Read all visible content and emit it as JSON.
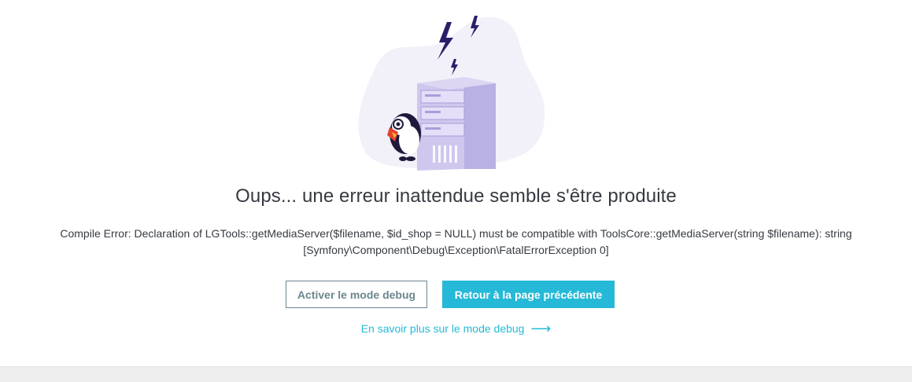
{
  "error_page": {
    "title": "Oups... une erreur inattendue semble s'être produite",
    "message_line1": "Compile Error: Declaration of LGTools::getMediaServer($filename, $id_shop = NULL) must be compatible with ToolsCore::getMediaServer(string $filename): string",
    "message_line2": "[Symfony\\Component\\Debug\\Exception\\FatalErrorException 0]",
    "debug_button_label": "Activer le mode debug",
    "back_button_label": "Retour à la page précédente",
    "learn_more_label": "En savoir plus sur le mode debug",
    "learn_more_icon": "arrow-right-icon"
  },
  "illustration": {
    "icons": [
      "server-icon",
      "lightning-bolt-icon",
      "puffin-mascot-icon"
    ]
  },
  "colors": {
    "text": "#363a41",
    "accent": "#25b9d7",
    "secondary": "#6c868e",
    "illustration_blob": "#f2f1f9",
    "server": "#cfc7ee",
    "lightning": "#2c1d6b",
    "footer": "#eeeeee"
  }
}
